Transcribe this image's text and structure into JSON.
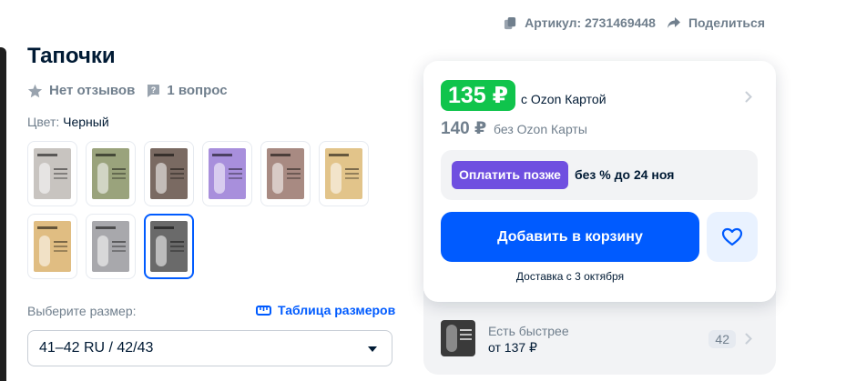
{
  "meta": {
    "article": "Артикул: 2731469448",
    "share": "Поделиться"
  },
  "product": {
    "title": "Тапочки",
    "reviews": "Нет отзывов",
    "questions": "1 вопрос",
    "color_label": "Цвет:",
    "color_value": "Черный",
    "swatches": [
      {
        "bg": "#c8c4c0",
        "selected": false
      },
      {
        "bg": "#9aa37c",
        "selected": false
      },
      {
        "bg": "#7a6a62",
        "selected": false
      },
      {
        "bg": "#a88fdc",
        "selected": false
      },
      {
        "bg": "#a88a82",
        "selected": false
      },
      {
        "bg": "#e2c48a",
        "selected": false
      },
      {
        "bg": "#e0bd82",
        "selected": false
      },
      {
        "bg": "#a8a8ac",
        "selected": false
      },
      {
        "bg": "#6a6a6a",
        "selected": true
      }
    ]
  },
  "size": {
    "label": "Выберите размер:",
    "table_link": "Таблица размеров",
    "selected": "41–42 RU / 42/43"
  },
  "price_card": {
    "price": "135 ₽",
    "price_caption": "с Ozon Картой",
    "alt_price": "140 ₽",
    "alt_caption": "без Ozon Карты",
    "pay_later_button": "Оплатить позже",
    "pay_later_text": "без % до 24 ноя",
    "cart_button": "Добавить в корзину",
    "delivery": "Доставка с 3 октября"
  },
  "faster": {
    "title": "Есть быстрее",
    "price": "от 137 ₽",
    "count": "42"
  },
  "colors": {
    "accent": "#005bff",
    "price_green": "#10c44c",
    "pay_later": "#6f4fe0",
    "text": "#001a34",
    "muted": "#707f8d"
  }
}
